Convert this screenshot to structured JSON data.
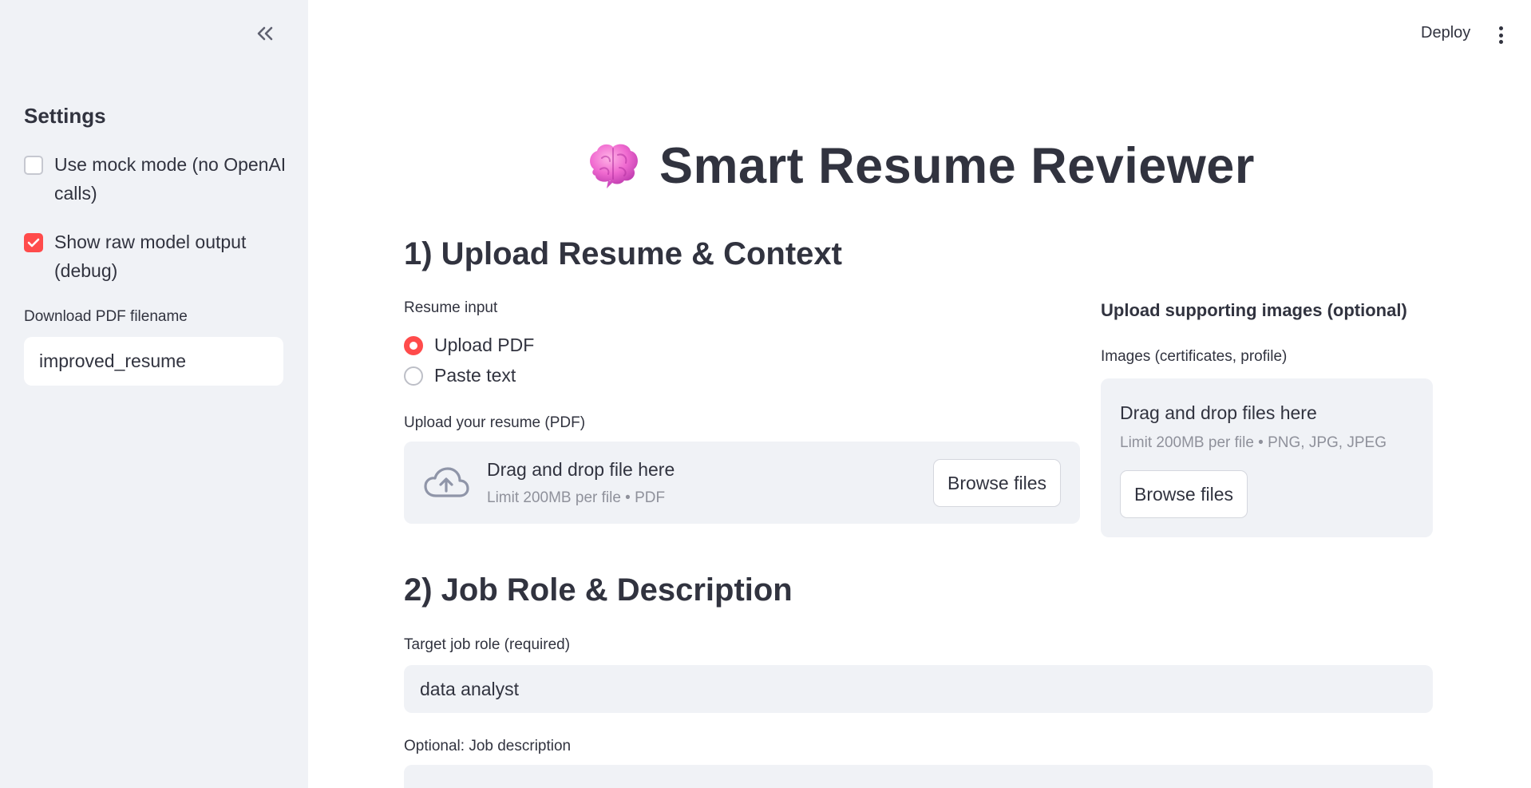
{
  "sidebar": {
    "heading": "Settings",
    "checkboxes": [
      {
        "label": "Use mock mode (no OpenAI calls)",
        "checked": false
      },
      {
        "label": "Show raw model output (debug)",
        "checked": true
      }
    ],
    "filename_label": "Download PDF filename",
    "filename_value": "improved_resume"
  },
  "header": {
    "deploy_label": "Deploy"
  },
  "main": {
    "title": "Smart Resume Reviewer",
    "title_icon": "brain-emoji",
    "section1": {
      "heading": "1) Upload Resume & Context",
      "resume_input_label": "Resume input",
      "radio_options": [
        {
          "label": "Upload PDF",
          "selected": true
        },
        {
          "label": "Paste text",
          "selected": false
        }
      ],
      "upload_label": "Upload your resume (PDF)",
      "dropzone": {
        "title": "Drag and drop file here",
        "subtitle": "Limit 200MB per file • PDF",
        "button": "Browse files"
      },
      "images": {
        "heading": "Upload supporting images (optional)",
        "label": "Images (certificates, profile)",
        "dropzone_title": "Drag and drop files here",
        "dropzone_subtitle": "Limit 200MB per file • PNG, JPG, JPEG",
        "button": "Browse files"
      }
    },
    "section2": {
      "heading": "2) Job Role & Description",
      "job_role_label": "Target job role (required)",
      "job_role_value": "data analyst",
      "job_desc_label": "Optional: Job description",
      "job_desc_value": ""
    }
  },
  "colors": {
    "accent": "#ff4b4b",
    "sidebar_bg": "#f0f2f6",
    "text": "#31333f",
    "muted": "#8f919b"
  }
}
